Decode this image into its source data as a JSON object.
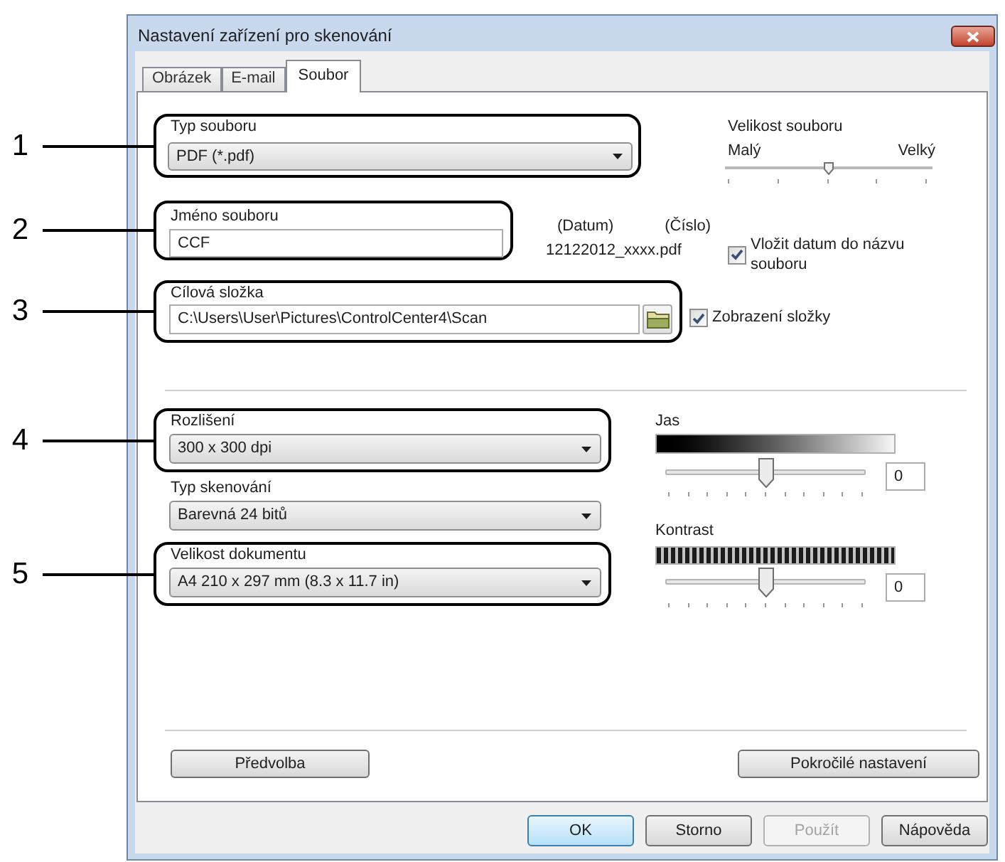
{
  "window": {
    "title": "Nastavení zařízení pro skenování"
  },
  "tabs": [
    {
      "label": "Obrázek",
      "selected": false
    },
    {
      "label": "E-mail",
      "selected": false
    },
    {
      "label": "Soubor",
      "selected": true
    }
  ],
  "file_type": {
    "callout": "1",
    "label": "Typ souboru",
    "value": "PDF (*.pdf)"
  },
  "file_size": {
    "label": "Velikost souboru",
    "min_label": "Malý",
    "max_label": "Velký",
    "level": 0.5
  },
  "file_name": {
    "callout": "2",
    "label": "Jméno souboru",
    "value": "CCF"
  },
  "name_format": {
    "date_label": "(Datum)",
    "number_label": "(Číslo)",
    "example": "12122012_xxxx.pdf"
  },
  "insert_date": {
    "label": "Vložit datum do názvu souboru",
    "checked": true
  },
  "destination_folder": {
    "callout": "3",
    "label": "Cílová složka",
    "value": "C:\\Users\\User\\Pictures\\ControlCenter4\\Scan"
  },
  "show_folder": {
    "label": "Zobrazení složky",
    "checked": true
  },
  "resolution": {
    "callout": "4",
    "label": "Rozlišení",
    "value": "300 x 300 dpi"
  },
  "scan_type": {
    "label": "Typ skenování",
    "value": "Barevná 24 bitů"
  },
  "document_size": {
    "callout": "5",
    "label": "Velikost dokumentu",
    "value": "A4 210 x 297 mm (8.3 x 11.7 in)"
  },
  "brightness": {
    "label": "Jas",
    "level": 0.5,
    "value": "0"
  },
  "contrast": {
    "label": "Kontrast",
    "level": 0.5,
    "value": "0"
  },
  "panel_buttons": [
    "Předvolba",
    "Pokročilé nastavení"
  ],
  "dialog_buttons": [
    {
      "label": "OK",
      "default": true,
      "disabled": false
    },
    {
      "label": "Storno",
      "default": false,
      "disabled": false
    },
    {
      "label": "Použít",
      "default": false,
      "disabled": true
    },
    {
      "label": "Nápověda",
      "default": false,
      "disabled": false
    }
  ]
}
